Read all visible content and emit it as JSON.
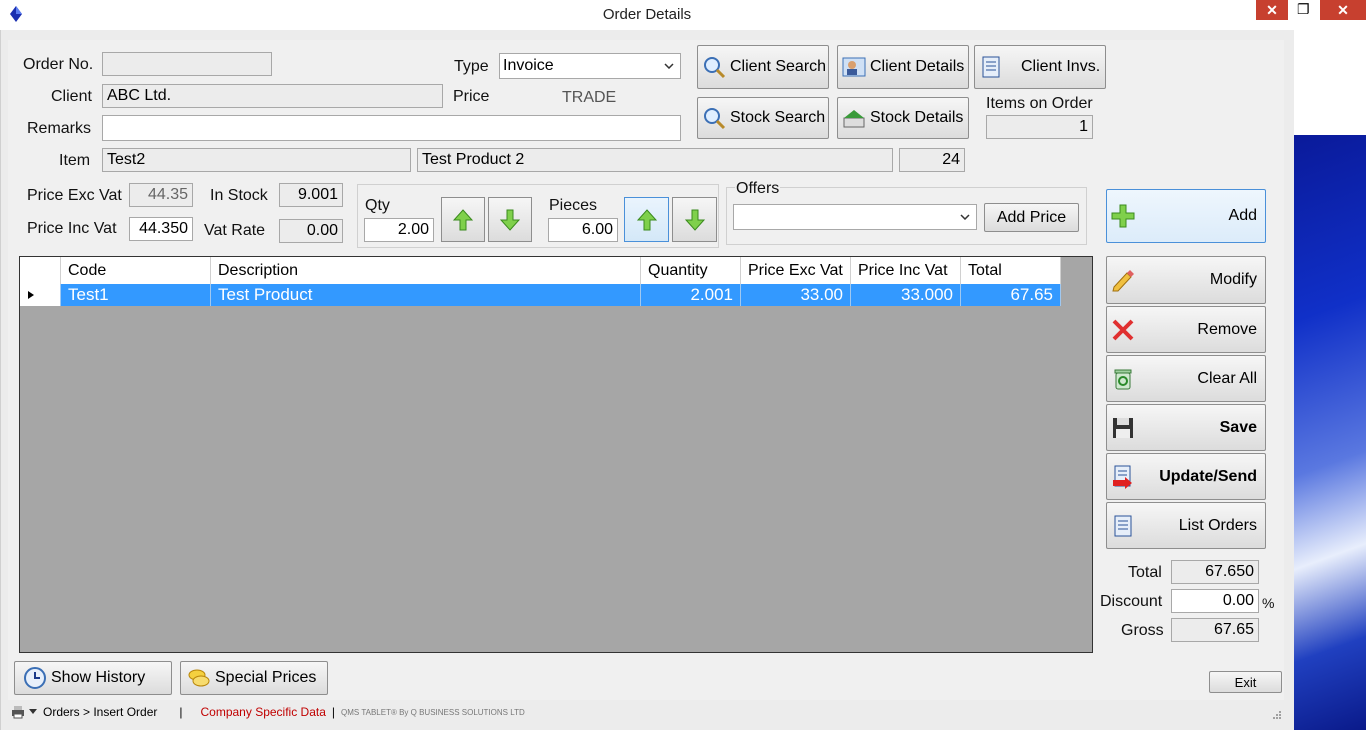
{
  "window": {
    "title": "Order Details",
    "close_label": "✕",
    "restore_label": "❐"
  },
  "colors": {
    "selection": "#3399ff",
    "status_red": "#c00000",
    "grid_bg": "#a6a6a6"
  },
  "form": {
    "order_no": {
      "label": "Order No.",
      "value": ""
    },
    "type": {
      "label": "Type",
      "value": "Invoice"
    },
    "client": {
      "label": "Client",
      "value": "ABC Ltd."
    },
    "price": {
      "label": "Price",
      "value": "TRADE"
    },
    "remarks": {
      "label": "Remarks",
      "value": ""
    },
    "item": {
      "label": "Item",
      "code": "Test2",
      "description": "Test Product 2",
      "stock_count": "24"
    },
    "items_on_order": {
      "label": "Items on Order",
      "value": "1"
    },
    "price_exc_vat": {
      "label": "Price Exc Vat",
      "value": "44.35"
    },
    "price_inc_vat": {
      "label": "Price Inc Vat",
      "value": "44.350"
    },
    "in_stock": {
      "label": "In Stock",
      "value": "9.001"
    },
    "vat_rate": {
      "label": "Vat Rate",
      "value": "0.00"
    },
    "qty": {
      "label": "Qty",
      "value": "2.00"
    },
    "pieces": {
      "label": "Pieces",
      "value": "6.00"
    },
    "offers": {
      "label": "Offers",
      "value": ""
    }
  },
  "buttons": {
    "client_search": "Client Search",
    "client_details": "Client  Details",
    "client_invs": "Client  Invs.",
    "stock_search": "Stock Search",
    "stock_details": "Stock Details",
    "add_price": "Add Price",
    "add": "Add",
    "modify": "Modify",
    "remove": "Remove",
    "clear_all": "Clear All",
    "save": "Save",
    "update_send": "Update/Send",
    "list_orders": "List Orders",
    "show_history": "Show History",
    "special_prices": "Special Prices",
    "exit": "Exit"
  },
  "grid": {
    "columns": [
      "Code",
      "Description",
      "Quantity",
      "Price Exc Vat",
      "Price Inc Vat",
      "Total"
    ],
    "rows": [
      {
        "code": "Test1",
        "description": "Test Product",
        "quantity": "2.001",
        "price_exc_vat": "33.00",
        "price_inc_vat": "33.000",
        "total": "67.65"
      }
    ]
  },
  "totals": {
    "total": {
      "label": "Total",
      "value": "67.650"
    },
    "discount": {
      "label": "Discount",
      "value": "0.00",
      "unit": "%"
    },
    "gross": {
      "label": "Gross",
      "value": "67.65"
    }
  },
  "statusbar": {
    "breadcrumb": "Orders > Insert Order",
    "separator": "|",
    "company": "Company Specific Data",
    "credit": "QMS TABLET® By Q BUSINESS SOLUTIONS LTD"
  }
}
